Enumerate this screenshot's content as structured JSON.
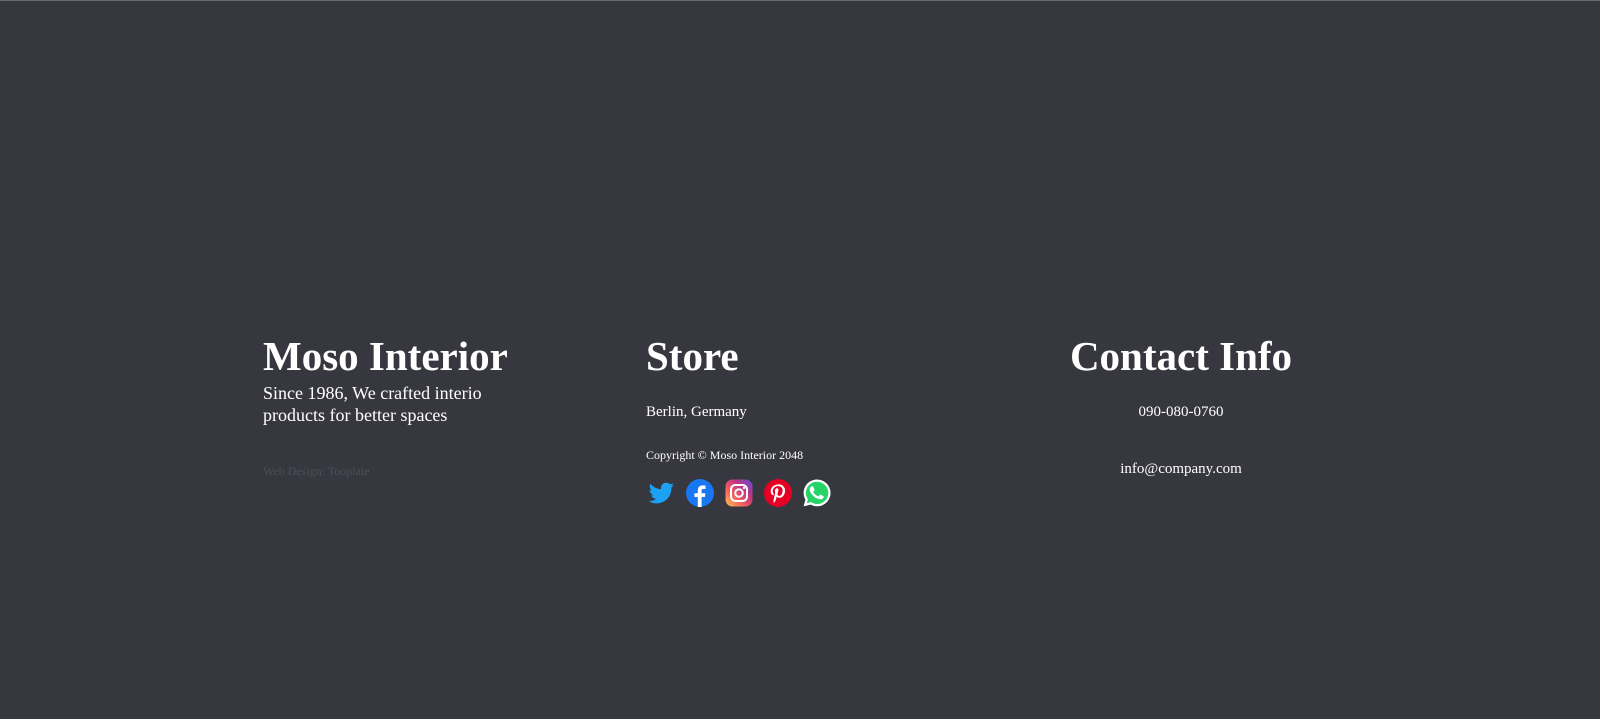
{
  "brand": {
    "title": "Moso Interior",
    "tagline": "Since 1986, We crafted interio products for better spaces",
    "credit": "Web Design: Tooplate"
  },
  "store": {
    "title": "Store",
    "location": "Berlin, Germany",
    "copyright": "Copyright © Moso Interior 2048",
    "social": [
      {
        "icon": "twitter-icon",
        "color": "#1da1f2"
      },
      {
        "icon": "facebook-icon",
        "color": "#1877f2"
      },
      {
        "icon": "instagram-icon",
        "color": "#c13584"
      },
      {
        "icon": "pinterest-icon",
        "color": "#e60023"
      },
      {
        "icon": "whatsapp-icon",
        "color": "#25d366"
      }
    ]
  },
  "contact": {
    "title": "Contact Info",
    "phone": "090-080-0760",
    "email": "info@company.com"
  },
  "colors": {
    "background": "#373740",
    "text": "#ffffff",
    "muted": "#4e4e57"
  }
}
